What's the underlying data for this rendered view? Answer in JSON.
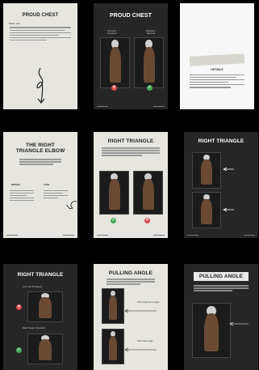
{
  "pages": [
    {
      "title": "PROUD CHEST",
      "subtitle": "Setup / Cue"
    },
    {
      "title": "PROUD CHEST",
      "label_left": "Rounded / Protracted",
      "label_right": "Expanded / Retracted"
    },
    {
      "title": "DETAILS"
    },
    {
      "title_line1": "THE RIGHT",
      "title_line2": "TRIANGLE ELBOW",
      "section_left": "DETAILS",
      "section_right": "CUES"
    },
    {
      "title": "RIGHT TRIANGLE",
      "mark_left": "✓",
      "mark_right": "✕"
    },
    {
      "title": "RIGHT TRIANGLE"
    },
    {
      "title": "RIGHT TRIANGLE",
      "label_top": "Less Than 90 Degrees",
      "label_bottom": "Right Triangle = Retraction"
    },
    {
      "title": "PULLING ANGLE",
      "label_one": "Pull to body from a height",
      "label_two": "Pull to lower angle"
    },
    {
      "title": "PULLING ANGLE"
    }
  ]
}
